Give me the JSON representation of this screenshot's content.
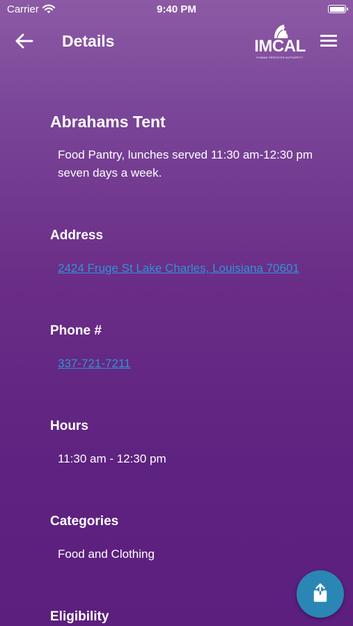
{
  "status": {
    "carrier": "Carrier",
    "time": "9:40 PM"
  },
  "nav": {
    "title": "Details",
    "logo_text": "IMCAL",
    "logo_subtext": "HUMAN SERVICES AUTHORITY"
  },
  "place": {
    "name": "Abrahams Tent",
    "description": "Food Pantry, lunches served 11:30 am-12:30 pm seven days a week."
  },
  "sections": {
    "address": {
      "label": "Address",
      "value": "2424 Fruge St Lake Charles, Louisiana 70601"
    },
    "phone": {
      "label": "Phone #",
      "value": "337-721-7211"
    },
    "hours": {
      "label": "Hours",
      "value": "11:30 am - 12:30 pm"
    },
    "categories": {
      "label": "Categories",
      "value": "Food and Clothing"
    },
    "eligibility": {
      "label": "Eligibility"
    }
  },
  "colors": {
    "link": "#2f93d5",
    "fab": "#2a86b4",
    "background_top": "#8c5aa5",
    "background_bottom": "#5c1f7e"
  },
  "icons": {
    "back": "arrow-left",
    "menu": "hamburger",
    "share": "share-upload",
    "wifi": "wifi",
    "battery": "battery-full"
  }
}
